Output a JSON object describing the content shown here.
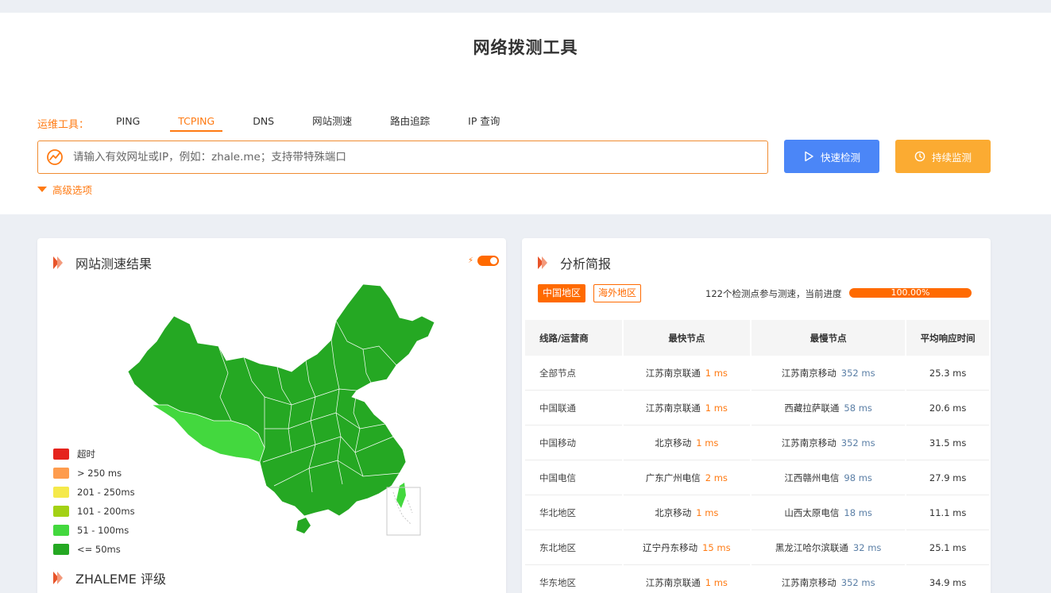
{
  "page_title": "网络拨测工具",
  "tools": {
    "label": "运维工具：",
    "tabs": [
      {
        "label": "PING",
        "active": false
      },
      {
        "label": "TCPING",
        "active": true
      },
      {
        "label": "DNS",
        "active": false
      },
      {
        "label": "网站测速",
        "active": false
      },
      {
        "label": "路由追踪",
        "active": false
      },
      {
        "label": "IP 查询",
        "active": false
      }
    ]
  },
  "search": {
    "placeholder": "请输入有效网址或IP，例如：zhale.me；支持带特殊端口",
    "value": ""
  },
  "buttons": {
    "quick": "快速检测",
    "monitor": "持续监测"
  },
  "advanced_label": "高级选项",
  "left_card": {
    "title": "网站测速结果",
    "legend": [
      {
        "label": "超时",
        "color": "#e5231d"
      },
      {
        "label": "> 250 ms",
        "color": "#fe9c4e"
      },
      {
        "label": "201 - 250ms",
        "color": "#f5e94a"
      },
      {
        "label": "101 - 200ms",
        "color": "#a3d114"
      },
      {
        "label": "51 - 100ms",
        "color": "#43d83e"
      },
      {
        "label": "<= 50ms",
        "color": "#25a823"
      }
    ],
    "rating_title": "ZHALEME 评级"
  },
  "right_card": {
    "title": "分析简报",
    "tags": [
      "中国地区",
      "海外地区"
    ],
    "progress_text": "122个检测点参与测速，当前进度",
    "progress_value": "100.00%",
    "progress_fraction": 1.0,
    "headers": [
      "线路/运营商",
      "最快节点",
      "最慢节点",
      "平均响应时间"
    ],
    "rows": [
      {
        "line": "全部节点",
        "fast_node": "江苏南京联通",
        "fast_ms": "1 ms",
        "slow_node": "江苏南京移动",
        "slow_ms": "352 ms",
        "avg": "25.3 ms"
      },
      {
        "line": "中国联通",
        "fast_node": "江苏南京联通",
        "fast_ms": "1 ms",
        "slow_node": "西藏拉萨联通",
        "slow_ms": "58 ms",
        "avg": "20.6 ms"
      },
      {
        "line": "中国移动",
        "fast_node": "北京移动",
        "fast_ms": "1 ms",
        "slow_node": "江苏南京移动",
        "slow_ms": "352 ms",
        "avg": "31.5 ms"
      },
      {
        "line": "中国电信",
        "fast_node": "广东广州电信",
        "fast_ms": "2 ms",
        "slow_node": "江西赣州电信",
        "slow_ms": "98 ms",
        "avg": "27.9 ms"
      },
      {
        "line": "华北地区",
        "fast_node": "北京移动",
        "fast_ms": "1 ms",
        "slow_node": "山西太原电信",
        "slow_ms": "18 ms",
        "avg": "11.1 ms"
      },
      {
        "line": "东北地区",
        "fast_node": "辽宁丹东移动",
        "fast_ms": "15 ms",
        "slow_node": "黑龙江哈尔滨联通",
        "slow_ms": "32 ms",
        "avg": "25.1 ms"
      },
      {
        "line": "华东地区",
        "fast_node": "江苏南京联通",
        "fast_ms": "1 ms",
        "slow_node": "江苏南京移动",
        "slow_ms": "352 ms",
        "avg": "34.9 ms"
      }
    ]
  },
  "colors": {
    "accent": "#ff6a00",
    "primary_button": "#4b86f7",
    "monitor_button": "#fbab32",
    "map_dark": "#25a823",
    "map_light": "#43d83e"
  }
}
